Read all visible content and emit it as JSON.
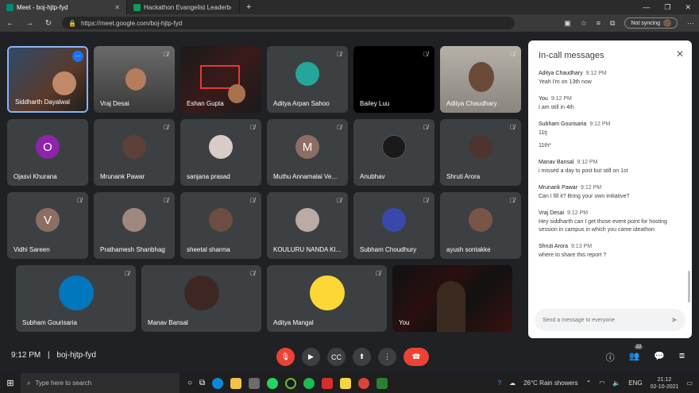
{
  "browser": {
    "tabs": [
      {
        "title": "Meet - boj-hjtp-fyd",
        "active": true,
        "icon": "meet-icon"
      },
      {
        "title": "Hackathon Evangelist Leaderboa",
        "active": false,
        "icon": "sheets-icon"
      }
    ],
    "url": "https://meet.google.com/boj-hjtp-fyd",
    "sync_label": "Not syncing"
  },
  "participants": [
    {
      "name": "Siddharth Dayalwal",
      "type": "video"
    },
    {
      "name": "Vraj Desai",
      "type": "video"
    },
    {
      "name": "Eshan Gupta",
      "type": "video"
    },
    {
      "name": "Aditya Arpan Sahoo",
      "type": "photo"
    },
    {
      "name": "Bailey Luu",
      "type": "blank"
    },
    {
      "name": "Aditya Chaudhary",
      "type": "video"
    },
    {
      "name": "Ojasvi Khurana",
      "type": "letter",
      "letter": "O",
      "color": "#8e24aa"
    },
    {
      "name": "Mrunank Pawar",
      "type": "photo"
    },
    {
      "name": "sanjana prasad",
      "type": "photo"
    },
    {
      "name": "Muthu Annamalai Ve...",
      "type": "letter",
      "letter": "M",
      "color": "#8d6e63"
    },
    {
      "name": "Anubhav",
      "type": "photo"
    },
    {
      "name": "Shruti Arora",
      "type": "photo"
    },
    {
      "name": "Vidhi Sareen",
      "type": "letter",
      "letter": "V",
      "color": "#8d6e63"
    },
    {
      "name": "Prathamesh Shanbhag",
      "type": "photo"
    },
    {
      "name": "sheetal sharma",
      "type": "photo"
    },
    {
      "name": "KOULURU NANDA KI...",
      "type": "photo"
    },
    {
      "name": "Subham Choudhury",
      "type": "photo"
    },
    {
      "name": "ayush sontakke",
      "type": "photo"
    },
    {
      "name": "Subham Gourisaria",
      "type": "photo"
    },
    {
      "name": "Manav Bansal",
      "type": "photo"
    },
    {
      "name": "Aditya Mangal",
      "type": "photo"
    },
    {
      "name": "You",
      "type": "video"
    }
  ],
  "chat": {
    "title": "In-call messages",
    "messages": [
      {
        "sender": "Aditya Chaudhary",
        "time": "9:12 PM",
        "lines": [
          "Yeah I'm on 13th now"
        ]
      },
      {
        "sender": "You",
        "time": "9:12 PM",
        "lines": [
          "I am still in 4th"
        ]
      },
      {
        "sender": "Subham Gourisaria",
        "time": "9:12 PM",
        "lines": [
          "11tj",
          "11th*"
        ]
      },
      {
        "sender": "Manav Bansal",
        "time": "9:12 PM",
        "lines": [
          "i missed a day to post but still on 1st"
        ]
      },
      {
        "sender": "Mrunank Pawar",
        "time": "9:12 PM",
        "lines": [
          "Can I fill it? Bring your own initiative?"
        ]
      },
      {
        "sender": "Vraj Desai",
        "time": "9:12 PM",
        "lines": [
          "Hey siddharth can I get those event point for hosting session in campus in which you came ideathon"
        ]
      },
      {
        "sender": "Shruti Arora",
        "time": "9:13 PM",
        "lines": [
          "where to share this report ?"
        ]
      }
    ],
    "input_placeholder": "Send a message to everyone"
  },
  "meeting": {
    "time": "9:12 PM",
    "code": "boj-hjtp-fyd",
    "people_count": "22"
  },
  "taskbar": {
    "search_placeholder": "Type here to search",
    "weather": "26°C  Rain showers",
    "lang": "ENG",
    "clock_time": "21:12",
    "clock_date": "02-10-2021"
  }
}
